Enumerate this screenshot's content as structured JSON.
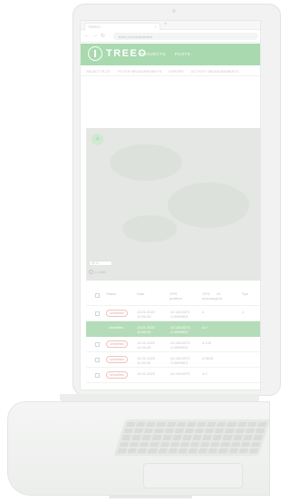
{
  "browser": {
    "tab_title": "TREEO",
    "url": "treeo.one/dashboard"
  },
  "app": {
    "brand": "TREEO",
    "nav": [
      "PROJECTS",
      "PLOTS"
    ]
  },
  "toolbar": {
    "items": [
      "SELECT PLOT",
      "FILTER MEASUREMENTS",
      "EXPORT",
      "ACTIVITY MEASUREMENTS"
    ]
  },
  "map": {
    "zoom_symbol": "+",
    "scale_label": "50 m",
    "attribution": "Leaflet"
  },
  "table": {
    "headers": {
      "status": "Status",
      "date": "Date",
      "gps": "GPS\nposition",
      "accuracy": "GPS\naccuracy",
      "height": "Ht\n(m)",
      "more": "Spe"
    },
    "rows": [
      {
        "status": "Unverified",
        "date": "13.01.2022\n11:06:43",
        "gps": "-10.1810373\n-3.3499813",
        "accuracy": "4",
        "height": "",
        "more": "1",
        "selected": false
      },
      {
        "status": "Unverified",
        "date": "13.01.2022\n11:06:43",
        "gps": "-10.1810373\n-3.3499813",
        "accuracy": "4.0",
        "height": "",
        "more": "",
        "selected": true
      },
      {
        "status": "Unverified",
        "date": "14.01.2022\n11:06:43",
        "gps": "-10.1810373\n-3.3499813",
        "accuracy": "4.130",
        "height": "",
        "more": "",
        "selected": false
      },
      {
        "status": "Unverified",
        "date": "14.01.2022\n11:06:43",
        "gps": "-10.1810373\n-3.3499813",
        "accuracy": "4.0615",
        "height": "",
        "more": "",
        "selected": false
      },
      {
        "status": "Unverified",
        "date": "14.01.2022",
        "gps": "-10.1810373",
        "accuracy": "4.0",
        "height": "",
        "more": "",
        "selected": false
      }
    ]
  },
  "colors": {
    "brand_green": "#a9d9ae",
    "selected_row": "#b4dcb8",
    "badge_red": "#e1a9a4"
  }
}
